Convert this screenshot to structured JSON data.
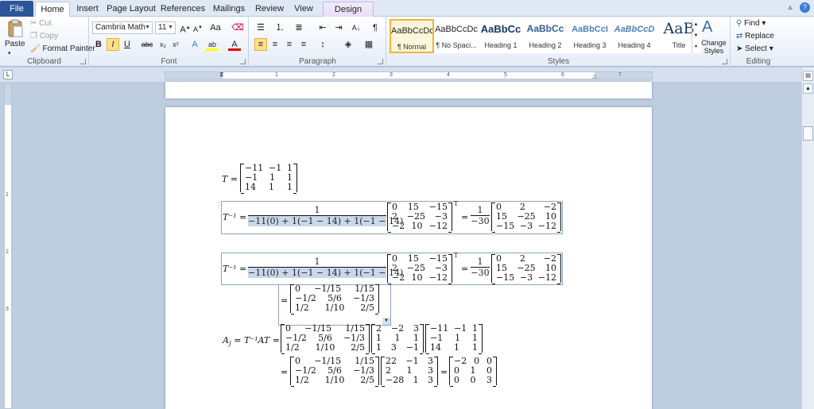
{
  "tabs": [
    "File",
    "Home",
    "Insert",
    "Page Layout",
    "References",
    "Mailings",
    "Review",
    "View",
    "Design"
  ],
  "clipboard": {
    "paste": "Paste",
    "cut": "Cut",
    "copy": "Copy",
    "format_painter": "Format Painter",
    "label": "Clipboard"
  },
  "font": {
    "name": "Cambria Math",
    "size": "11",
    "label": "Font"
  },
  "paragraph": {
    "label": "Paragraph"
  },
  "styles": {
    "label": "Styles",
    "items": [
      {
        "preview": "AaBbCcDc",
        "name": "¶ Normal"
      },
      {
        "preview": "AaBbCcDc",
        "name": "¶ No Spaci..."
      },
      {
        "preview": "AaBbCc",
        "name": "Heading 1"
      },
      {
        "preview": "AaBbCc",
        "name": "Heading 2"
      },
      {
        "preview": "AaBbCcI",
        "name": "Heading 3"
      },
      {
        "preview": "AaBbCcD",
        "name": "Heading 4"
      },
      {
        "preview": "AaB",
        "name": "Title"
      }
    ],
    "change_styles": "Change Styles"
  },
  "editing": {
    "find": "Find",
    "replace": "Replace",
    "select": "Select",
    "label": "Editing"
  },
  "ruler": {
    "numbers": [
      "1",
      "2",
      "3",
      "4",
      "5",
      "6",
      "7"
    ]
  },
  "vruler": {
    "numbers": [
      "1",
      "2",
      "3"
    ]
  },
  "document": {
    "T_label": "T =",
    "T_matrix": [
      [
        "−11",
        "−1",
        "1"
      ],
      [
        "−1",
        "1",
        "1"
      ],
      [
        "14",
        "1",
        "1"
      ]
    ],
    "inv_label": "T⁻¹ =",
    "inv_num": "1",
    "inv_den_pre": "−11(0) + ",
    "inv_den_rest": "1(−1 − 14) + 1(−1 − 14)",
    "adj_matrix": [
      [
        "0",
        "15",
        "−15"
      ],
      [
        "2",
        "−25",
        "−3"
      ],
      [
        "−2",
        "10",
        "−12"
      ]
    ],
    "transpose": "T",
    "eq_sign": "=",
    "scalar_num": "1",
    "scalar_den": "−30",
    "cof_matrix": [
      [
        "0",
        "2",
        "−2"
      ],
      [
        "15",
        "−25",
        "10"
      ],
      [
        "−15",
        "−3",
        "−12"
      ]
    ],
    "inv_result": [
      [
        "0",
        "−1/15",
        "1/15"
      ],
      [
        "−1/2",
        "5/6",
        "−1/3"
      ],
      [
        "1/2",
        "1/10",
        "2/5"
      ]
    ],
    "AJ_label": "A",
    "AJ_sub": "J",
    "AJ_rhs": " = T⁻¹AT =",
    "A_matrix": [
      [
        "2",
        "−2",
        "3"
      ],
      [
        "1",
        "1",
        "1"
      ],
      [
        "1",
        "3",
        "−1"
      ]
    ],
    "product1": [
      [
        "22",
        "−1",
        "3"
      ],
      [
        "2",
        "1",
        "3"
      ],
      [
        "−28",
        "1",
        "3"
      ]
    ],
    "jordan": [
      [
        "−2",
        "0",
        "0"
      ],
      [
        "0",
        "1",
        "0"
      ],
      [
        "0",
        "0",
        "3"
      ]
    ]
  }
}
